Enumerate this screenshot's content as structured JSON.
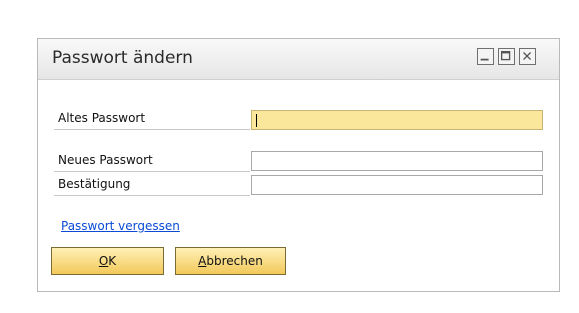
{
  "window": {
    "title": "Passwort ändern"
  },
  "form": {
    "old_password_label": "Altes Passwort",
    "new_password_label": "Neues Passwort",
    "confirm_label": "Bestätigung",
    "old_password_value": "",
    "new_password_value": "",
    "confirm_value": ""
  },
  "links": {
    "forgot_password": "Passwort vergessen"
  },
  "buttons": {
    "ok_accel": "O",
    "ok_rest": "K",
    "cancel_accel": "A",
    "cancel_rest": "bbrechen"
  },
  "colors": {
    "active_field": "#fbe79b",
    "button_top": "#fff0b6",
    "button_bottom": "#f2c95a",
    "link": "#0b4bd6"
  },
  "icons": {
    "minimize": "minimize-icon",
    "maximize": "maximize-icon",
    "close": "close-icon"
  }
}
